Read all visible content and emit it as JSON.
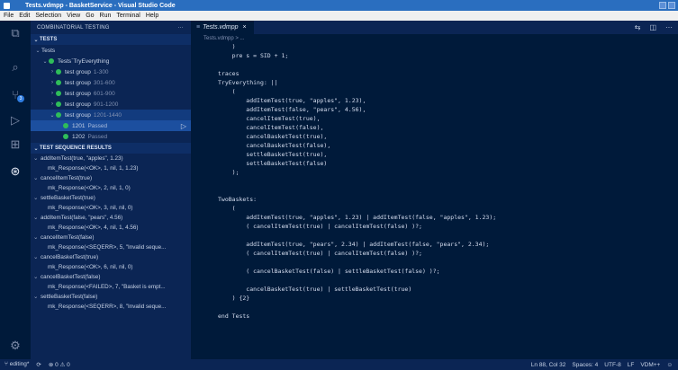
{
  "window": {
    "title": "Tests.vdmpp - BasketService - Visual Studio Code"
  },
  "menu": [
    "File",
    "Edit",
    "Selection",
    "View",
    "Go",
    "Run",
    "Terminal",
    "Help"
  ],
  "sidebar": {
    "title": "COMBINATORIAL TESTING",
    "more": "···",
    "tests_section": "TESTS",
    "tree": {
      "root": "Tests",
      "trace": "Tests`TryEverything",
      "groups": [
        {
          "label": "test group",
          "range": "1-300"
        },
        {
          "label": "test group",
          "range": "301-600"
        },
        {
          "label": "test group",
          "range": "601-900"
        },
        {
          "label": "test group",
          "range": "901-1200"
        },
        {
          "label": "test group",
          "range": "1201-1440"
        }
      ],
      "cases": [
        {
          "id": "1201",
          "status": "Passed"
        },
        {
          "id": "1202",
          "status": "Passed"
        }
      ]
    },
    "results_section": "TEST SEQUENCE RESULTS",
    "results": [
      {
        "call": "addItemTest(true, \"apples\", 1.23)",
        "response": "mk_Response(<OK>, 1, nil, 1, 1.23)"
      },
      {
        "call": "cancelItemTest(true)",
        "response": "mk_Response(<OK>, 2, nil, 1, 0)"
      },
      {
        "call": "settleBasketTest(true)",
        "response": "mk_Response(<OK>, 3, nil, nil, 0)"
      },
      {
        "call": "addItemTest(false, \"pears\", 4.56)",
        "response": "mk_Response(<OK>, 4, nil, 1, 4.56)"
      },
      {
        "call": "cancelItemTest(false)",
        "response": "mk_Response(<SEQERR>, 5, \"Invalid seque..."
      },
      {
        "call": "cancelBasketTest(true)",
        "response": "mk_Response(<OK>, 6, nil, nil, 0)"
      },
      {
        "call": "cancelBasketTest(false)",
        "response": "mk_Response(<FAILED>, 7, \"Basket is empt..."
      },
      {
        "call": "settleBasketTest(false)",
        "response": "mk_Response(<SEQERR>, 8, \"Invalid seque..."
      }
    ]
  },
  "editor": {
    "tab": "Tests.vdmpp",
    "breadcrumb": "Tests.vdmpp > ...",
    "lines": [
      "    )",
      "    pre s = SID + 1;",
      "",
      "traces",
      "TryEverything: ||",
      "    (",
      "        addItemTest(true, \"apples\", 1.23),",
      "        addItemTest(false, \"pears\", 4.56),",
      "        cancelItemTest(true),",
      "        cancelItemTest(false),",
      "        cancelBasketTest(true),",
      "        cancelBasketTest(false),",
      "        settleBasketTest(true),",
      "        settleBasketTest(false)",
      "    );",
      "",
      "",
      "TwoBaskets:",
      "    (",
      "        addItemTest(true, \"apples\", 1.23) | addItemTest(false, \"apples\", 1.23);",
      "        ( cancelItemTest(true) | cancelItemTest(false) )?;",
      "",
      "        addItemTest(true, \"pears\", 2.34) | addItemTest(false, \"pears\", 2.34);",
      "        ( cancelItemTest(true) | cancelItemTest(false) )?;",
      "",
      "        ( cancelBasketTest(false) | settleBasketTest(false) )?;",
      "",
      "        cancelBasketTest(true) | settleBasketTest(true)",
      "    ) {2}",
      "",
      "end Tests"
    ]
  },
  "status": {
    "branch": "editing*",
    "sync": "⟳",
    "problems": "⊗ 0 ⚠ 0",
    "position": "Ln 88, Col 32",
    "spaces": "Spaces: 4",
    "encoding": "UTF-8",
    "eol": "LF",
    "language": "VDM++"
  },
  "colors": {
    "accent": "#2a6ebf",
    "passed": "#2fbd5a",
    "background": "#001a3a"
  }
}
